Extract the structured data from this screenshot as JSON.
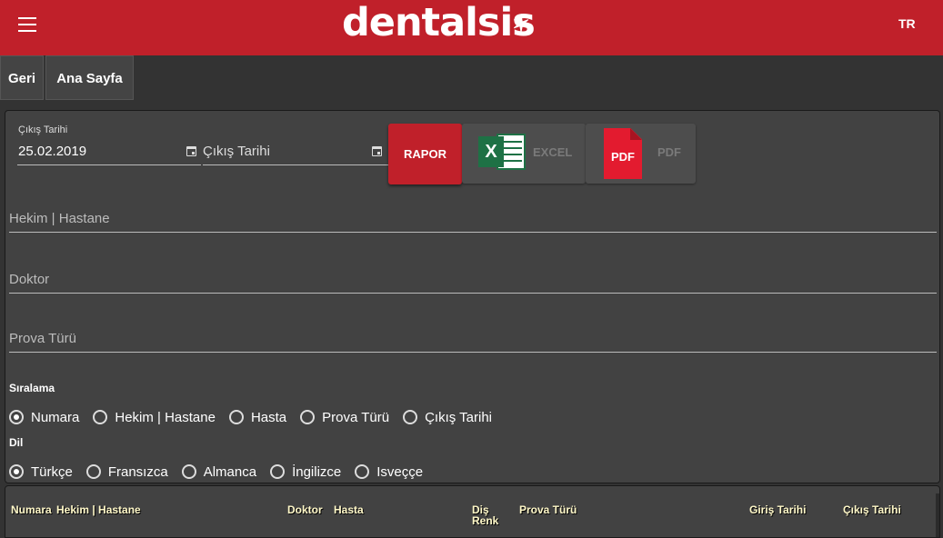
{
  "header": {
    "logo_text": "dentalsis",
    "logo_mark": "✶",
    "lang": "TR"
  },
  "nav": {
    "back": "Geri",
    "home": "Ana Sayfa"
  },
  "form": {
    "date_label": "Çıkış Tarihi",
    "start_date": "25.02.2019",
    "end_date_placeholder": "Çıkış Tarihi",
    "report_button": "RAPOR",
    "excel_button": "EXCEL",
    "excel_badge": "X",
    "pdf_button": "PDF",
    "pdf_badge": "PDF",
    "clinic_placeholder": "Hekim | Hastane",
    "doctor_placeholder": "Doktor",
    "trial_type_placeholder": "Prova Türü"
  },
  "sorting": {
    "label": "Sıralama",
    "options": [
      "Numara",
      "Hekim | Hastane",
      "Hasta",
      "Prova Türü",
      "Çıkış Tarihi"
    ],
    "selected": "Numara"
  },
  "language": {
    "label": "Dil",
    "options": [
      "Türkçe",
      "Fransızca",
      "Almanca",
      "İngilizce",
      "Isveççe"
    ],
    "selected": "Türkçe"
  },
  "table": {
    "columns": {
      "number": "Numara",
      "clinic": "Hekim | Hastane",
      "doctor": "Doktor",
      "patient": "Hasta",
      "tooth_color_1": "Diş",
      "tooth_color_2": "Renk",
      "trial_type": "Prova Türü",
      "entry_date": "Giriş Tarihi",
      "exit_date": "Çıkış Tarihi"
    }
  },
  "colors": {
    "brand": "#c0202a",
    "excel": "#1e7145",
    "pdf": "#e31b2f",
    "table_header_text": "#fff8c8"
  }
}
